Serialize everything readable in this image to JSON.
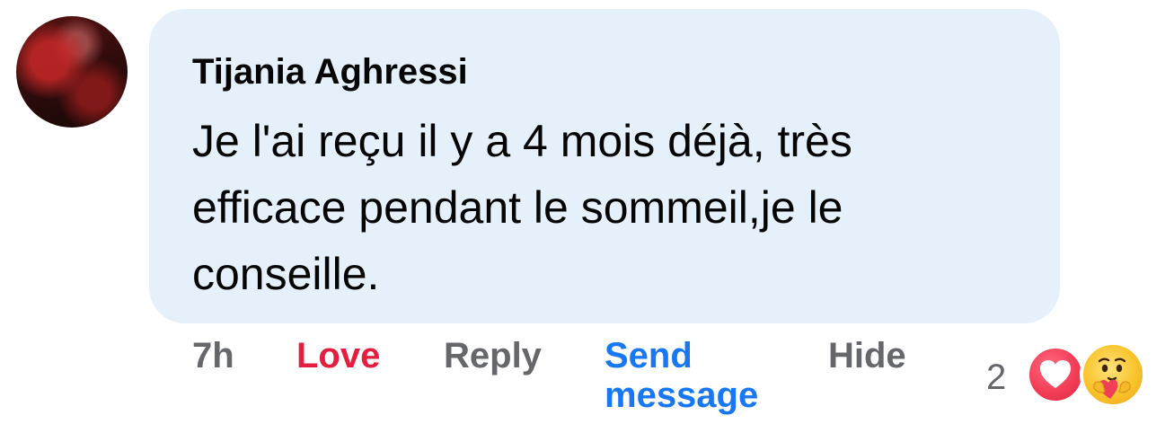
{
  "comment": {
    "author": "Tijania Aghressi",
    "text": "Je l'ai reçu il y a 4 mois déjà, très efficace pendant le sommeil,je le conseille."
  },
  "actions": {
    "time": "7h",
    "love": "Love",
    "reply": "Reply",
    "send_message": "Send message",
    "hide": "Hide"
  },
  "reactions": {
    "count": "2",
    "types": [
      "love-icon",
      "care-icon"
    ]
  },
  "colors": {
    "bubble_bg": "#e6f0fb",
    "love_red": "#e41e3f",
    "link_blue": "#1877f2",
    "muted_gray": "#65676b"
  }
}
